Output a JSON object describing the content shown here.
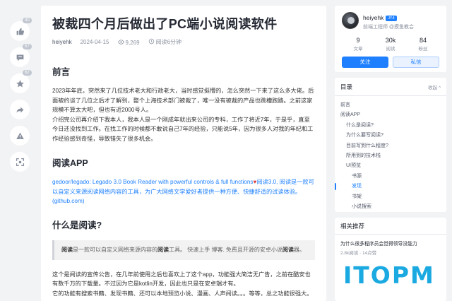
{
  "sidebar": {
    "buttons": [
      {
        "icon": "like-icon",
        "badge": "40"
      },
      {
        "icon": "comment-icon",
        "badge": "57"
      },
      {
        "icon": "star-icon",
        "badge": "62"
      },
      {
        "icon": "share-icon",
        "badge": ""
      },
      {
        "icon": "report-icon",
        "badge": ""
      },
      {
        "icon": "fullscreen-icon",
        "badge": ""
      }
    ]
  },
  "article": {
    "title": "被裁四个月后做出了PC端小说阅读软件",
    "author": "heiyehk",
    "date": "2024-04-15",
    "views": "9,269",
    "read_time": "阅读6分钟",
    "h_preface": "前言",
    "preface_p1": "2023年年底，突然来了几位技术老大和行政老大，当时感觉挺懵的，怎么突然一下来了这么多大佬。后面被约谈了几位之后才了解到，整个上海技术部门被裁了，唯一没有被裁的产品也跳槽跑路。之前这家规模不算太大吧，但也有近2000号人。",
    "preface_p2": "介绍完公司再介绍下我本人，我本人是一个刚成年就出来公司的专科，工作了将近7年，于是乎，直至今日还没找到工作。在找工作的时候都不敢说自己7年的经验，只能说5年，因为很多人对我的年纪和工作经验感到奇怪，导致错失了很多机会。",
    "h_app": "阅读APP",
    "app_link": "gedoor/legado: Legado 3.0 Book Reader with powerful controls & full functions",
    "app_link_desc": "阅读3.0, 阅读是一款可以自定义来源阅读网络内容的工具，为广大网络文学爱好者提供一种方便、快捷舒适的试读体验。(github.com)",
    "h_what": "什么是阅读?",
    "quote_bold1": "阅读",
    "quote_text1": "是一款可以自定义网络来源内容的",
    "quote_bold2": "阅读",
    "quote_text2": "工具。 快速上手 博客. 免费且开源的安卓小说",
    "quote_bold3": "阅读",
    "quote_text3": "器。",
    "body_p1": "这个是阅读的宣传公告，在几年前使用之后也喜欢上了这个app，功能强大简洁无广告，之前在酷安也有数千万的下载量。不过因为它是kotlin开发，因此也只是在安卓端才有。",
    "body_p2": "它的功能有搜索书籍、发现书籍、还可以本地预览小说、漫画、人声阅读。。。等等，总之功能很强大。"
  },
  "author_card": {
    "name": "heiyehk",
    "badge": "JY.4",
    "role": "前端工程师 @摸鱼教会",
    "stats": [
      {
        "num": "9",
        "label": "文章"
      },
      {
        "num": "30k",
        "label": "阅读"
      },
      {
        "num": "84",
        "label": "粉丝"
      }
    ],
    "follow_label": "关注",
    "message_label": "私信"
  },
  "toc": {
    "title": "目录",
    "collapse_label": "收起 ^",
    "items": [
      {
        "label": "前言",
        "level": 1,
        "active": false
      },
      {
        "label": "阅读APP",
        "level": 1,
        "active": false
      },
      {
        "label": "什么是阅读?",
        "level": 2,
        "active": false
      },
      {
        "label": "为什么要写阅读?",
        "level": 2,
        "active": false
      },
      {
        "label": "目前写到什么程度?",
        "level": 2,
        "active": false
      },
      {
        "label": "所用到的技术栈",
        "level": 2,
        "active": false
      },
      {
        "label": "UI预览",
        "level": 2,
        "active": false
      },
      {
        "label": "书源",
        "level": 3,
        "active": false
      },
      {
        "label": "发现",
        "level": 3,
        "active": true
      },
      {
        "label": "书架",
        "level": 3,
        "active": false
      },
      {
        "label": "小说搜索",
        "level": 3,
        "active": false
      }
    ]
  },
  "recommend": {
    "title": "相关推荐",
    "item_title": "为什么很多程序员会觉得领导没能力",
    "item_meta": "2.8k阅读 · 14点赞"
  },
  "watermark": "ITOPM",
  "colors": {
    "accent": "#1e80ff",
    "watermark": "#1aa9e0",
    "background": "#f2f3f5"
  }
}
